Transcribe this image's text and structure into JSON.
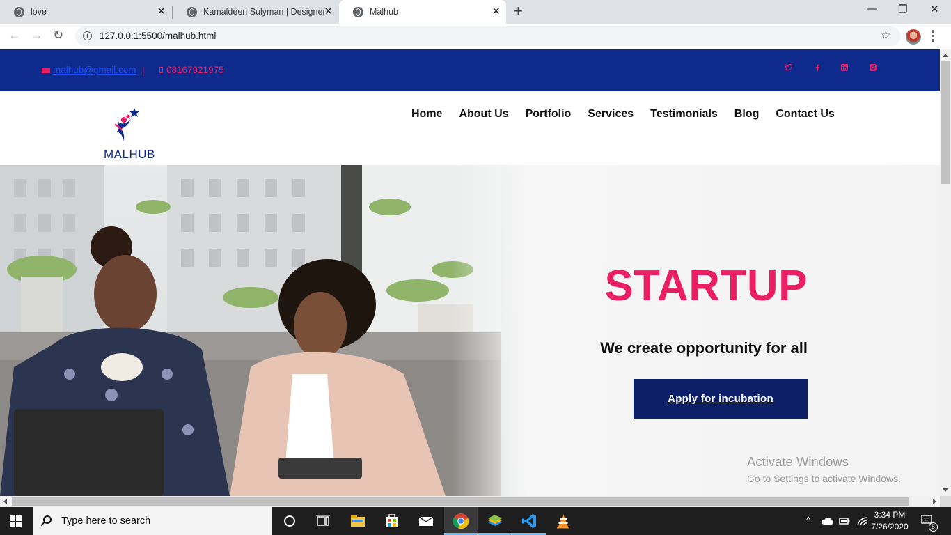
{
  "browser": {
    "tabs": [
      {
        "title": "love",
        "active": false
      },
      {
        "title": "Kamaldeen Sulyman | Designer",
        "active": false
      },
      {
        "title": "Malhub",
        "active": true
      }
    ],
    "url": "127.0.0.1:5500/malhub.html"
  },
  "topbar": {
    "email": "malhub@gmail.com",
    "separator": "|",
    "phone": "08167921975",
    "socials": [
      "twitter-icon",
      "facebook-icon",
      "linkedin-icon",
      "instagram-icon"
    ]
  },
  "header": {
    "logo_text": "MALHUB",
    "nav": [
      "Home",
      "About Us",
      "Portfolio",
      "Services",
      "Testimonials",
      "Blog",
      "Contact Us"
    ]
  },
  "hero": {
    "title": "STARTUP",
    "subtitle": "We create opportunity for all",
    "button": "Apply for incubation"
  },
  "watermark": {
    "line1": "Activate Windows",
    "line2": "Go to Settings to activate Windows."
  },
  "taskbar": {
    "search_placeholder": "Type here to search",
    "time": "3:34 PM",
    "date": "7/26/2020",
    "notification_count": "5"
  },
  "colors": {
    "brand_blue": "#0d2a8c",
    "button_navy": "#0d1f66",
    "accent_pink": "#e91e63"
  }
}
